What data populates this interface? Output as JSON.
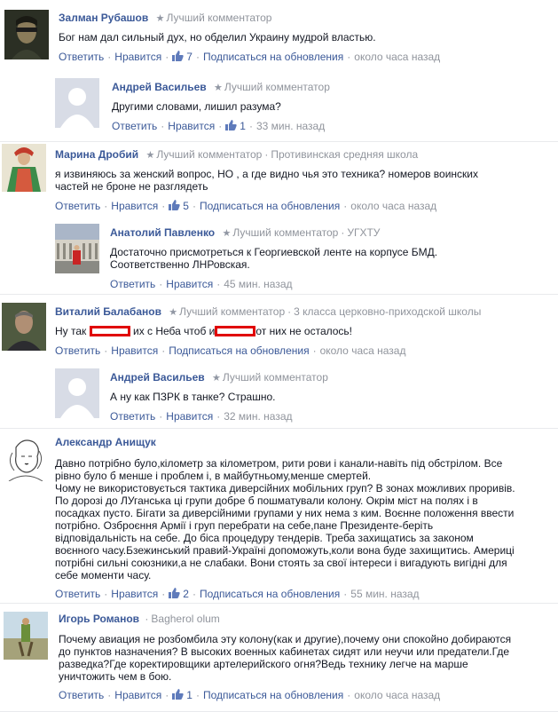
{
  "comments": [
    {
      "author": "Залман Рубашов",
      "badge": "Лучший комментатор",
      "affiliation": "",
      "text": "Бог нам дал сильный дух, но обделил Украину мудрой властью.",
      "reply_label": "Ответить",
      "like_label": "Нравится",
      "likes": "7",
      "subscribe_label": "Подписаться на обновления",
      "time": "около часа назад",
      "replies": [
        {
          "author": "Андрей Васильев",
          "badge": "Лучший комментатор",
          "text": "Другими словами, лишил разума?",
          "reply_label": "Ответить",
          "like_label": "Нравится",
          "likes": "1",
          "time": "33 мин. назад"
        }
      ]
    },
    {
      "author": "Марина Дробий",
      "badge": "Лучший комментатор",
      "affiliation": "Противинская средняя школа",
      "text": "я извиняюсь за женский вопрос, НО , а где видно чья это техника? номеров воинских частей не броне не разглядеть",
      "reply_label": "Ответить",
      "like_label": "Нравится",
      "likes": "5",
      "subscribe_label": "Подписаться на обновления",
      "time": "около часа назад",
      "replies": [
        {
          "author": "Анатолий Павленко",
          "badge": "Лучший комментатор",
          "affiliation": "УГХТУ",
          "text": "Достаточно присмотреться к Георгиевской ленте на корпусе БМД. Соответственно ЛНРовская.",
          "reply_label": "Ответить",
          "like_label": "Нравится",
          "time": "45 мин. назад"
        }
      ]
    },
    {
      "author": "Виталий Балабанов",
      "badge": "Лучший комментатор",
      "affiliation": "3 класса церковно-приходской школы",
      "text_part1": "Ну так",
      "text_part2": "их с Неба чтоб и",
      "text_part3": "от них не осталось!",
      "reply_label": "Ответить",
      "like_label": "Нравится",
      "subscribe_label": "Подписаться на обновления",
      "time": "около часа назад",
      "replies": [
        {
          "author": "Андрей Васильев",
          "badge": "Лучший комментатор",
          "text": "А ну как ПЗРК в танке? Страшно.",
          "reply_label": "Ответить",
          "like_label": "Нравится",
          "time": "32 мин. назад"
        }
      ]
    },
    {
      "author": "Александр Анищук",
      "text": "Давно потрібно було,кілометр за кілометром, рити рови і канали-навіть під обстрілом. Все рівно було б менше і проблем і, в майбутньому,менше смертей.\nЧому не використовується тактика диверсійних мобільних груп? В зонах можливих проривів. По дорозі до ЛУганська ці групи добре б пошматували колону. Окрім міст на полях і в посадках пусто. Бігати за диверсійними групами у них нема з ким. Воєнне положення ввести потрібно. Озброєння Армії і груп перебрати на себе,пане Президенте-беріть відповідальність на себе. До біса процедуру тендерів. Треба захищатись за законом воєнного часу.Бзежинський правий-Україні допоможуть,коли вона буде захищитись. Америці потрібні сильні союзники,а не слабаки. Вони стоять за свої інтереси і вигадують вигідні для себе моменти часу.",
      "reply_label": "Ответить",
      "like_label": "Нравится",
      "likes": "2",
      "subscribe_label": "Подписаться на обновления",
      "time": "55 мин. назад"
    },
    {
      "author": "Игорь Романов",
      "affiliation": "Bagherol olum",
      "text": "Почему авиация не розбомбила эту колону(как и другие),почему они спокойно добираются до пунктов назначения? В высоких военных кабинетах сидят или неучи или предатели.Где разведка?Где коректировщики артелерийского огня?Ведь технику легче на марше уничтожить чем в бою.",
      "reply_label": "Ответить",
      "like_label": "Нравится",
      "likes": "1",
      "subscribe_label": "Подписаться на обновления",
      "time": "около часа назад"
    }
  ]
}
